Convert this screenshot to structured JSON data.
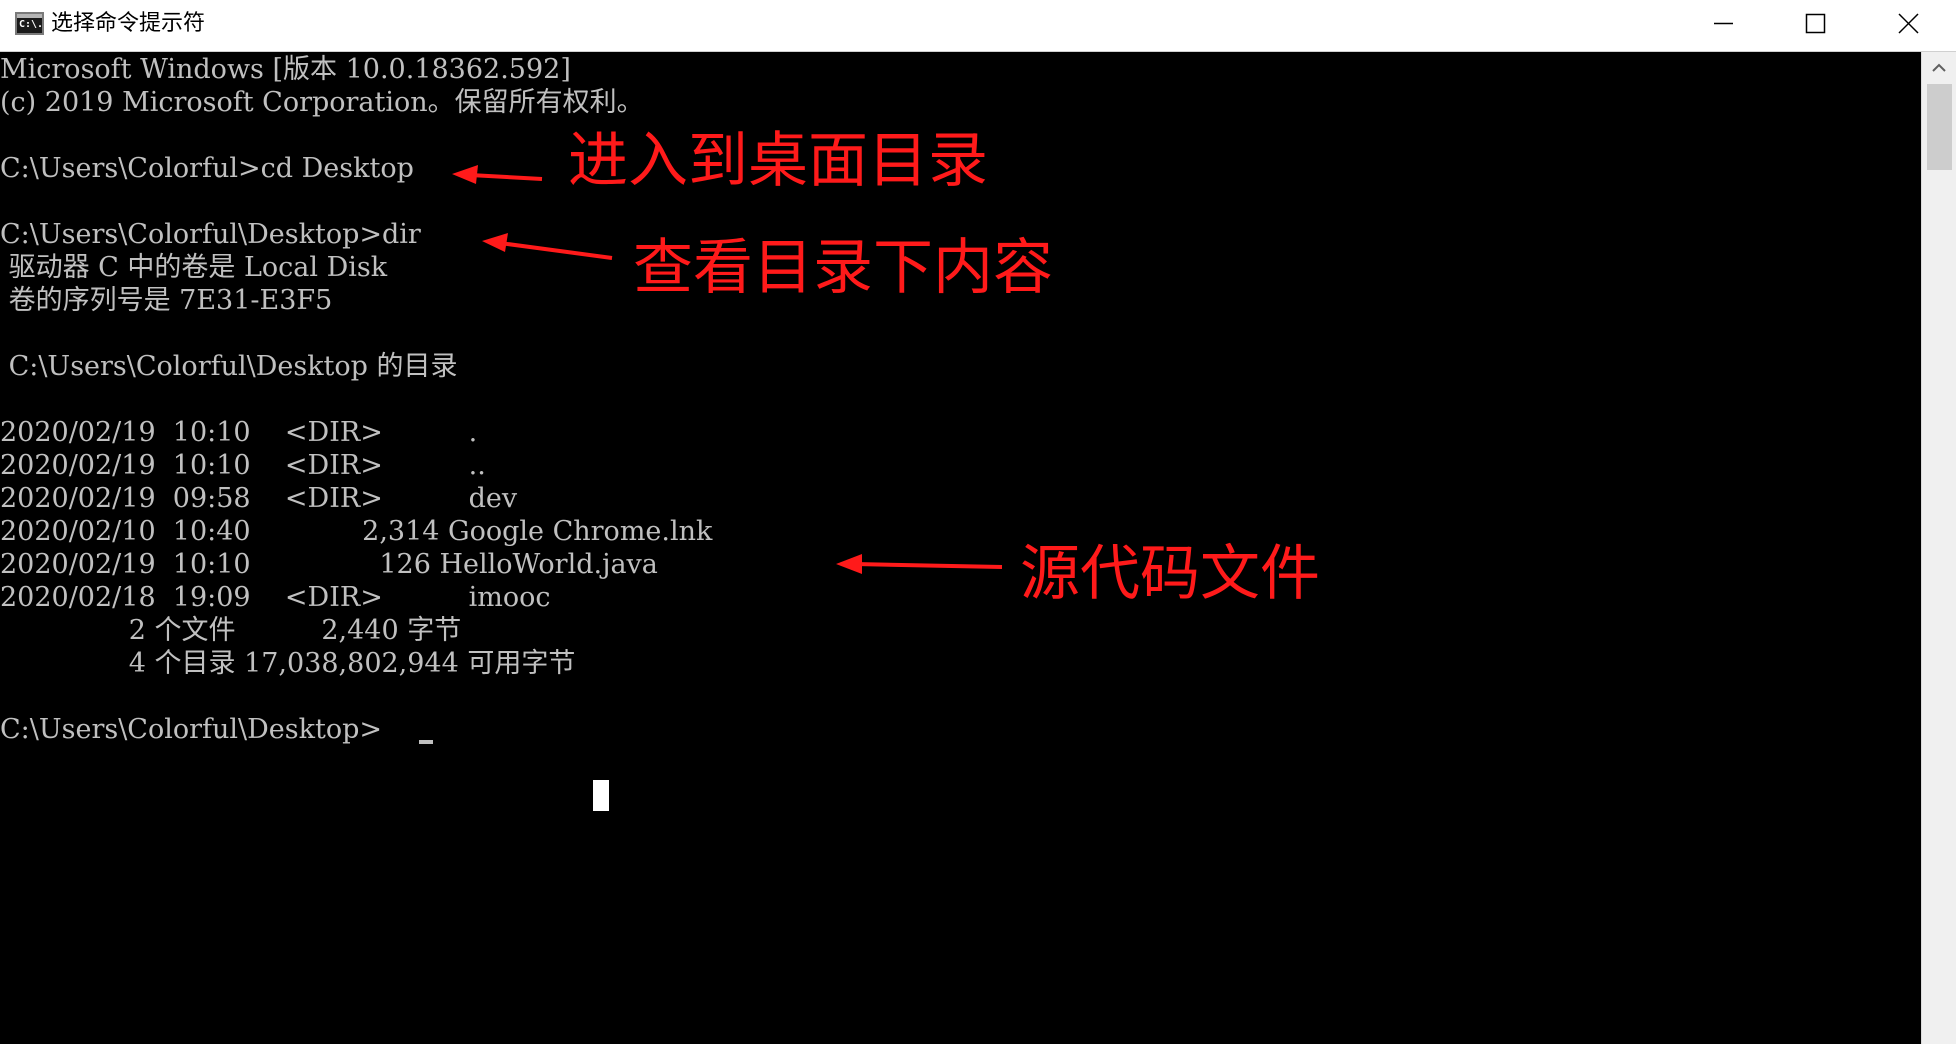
{
  "window": {
    "title": "选择命令提示符",
    "icon": "cmd-icon",
    "icon_glyph": "C:\\."
  },
  "controls": {
    "minimize_icon": "minimize-icon",
    "maximize_icon": "maximize-icon",
    "close_icon": "close-icon"
  },
  "console": {
    "lines": [
      "Microsoft Windows [版本 10.0.18362.592]",
      "(c) 2019 Microsoft Corporation。保留所有权利。",
      "",
      "C:\\Users\\Colorful>cd Desktop",
      "",
      "C:\\Users\\Colorful\\Desktop>dir",
      " 驱动器 C 中的卷是 Local Disk",
      " 卷的序列号是 7E31-E3F5",
      "",
      " C:\\Users\\Colorful\\Desktop 的目录",
      "",
      "2020/02/19  10:10    <DIR>          .",
      "2020/02/19  10:10    <DIR>          ..",
      "2020/02/19  09:58    <DIR>          dev",
      "2020/02/10  10:40             2,314 Google Chrome.lnk",
      "2020/02/19  10:10               126 HelloWorld.java",
      "2020/02/18  19:09    <DIR>          imooc",
      "               2 个文件          2,440 字节",
      "               4 个目录 17,038,802,944 可用字节",
      "",
      "C:\\Users\\Colorful\\Desktop>"
    ]
  },
  "annotations": {
    "cd_note": "进入到桌面目录",
    "dir_note": "查看目录下内容",
    "source_note": "源代码文件"
  },
  "colors": {
    "console_bg": "#000000",
    "console_text": "#c0c0c0",
    "annotation": "#ff1a1a",
    "titlebar_bg": "#ffffff"
  }
}
